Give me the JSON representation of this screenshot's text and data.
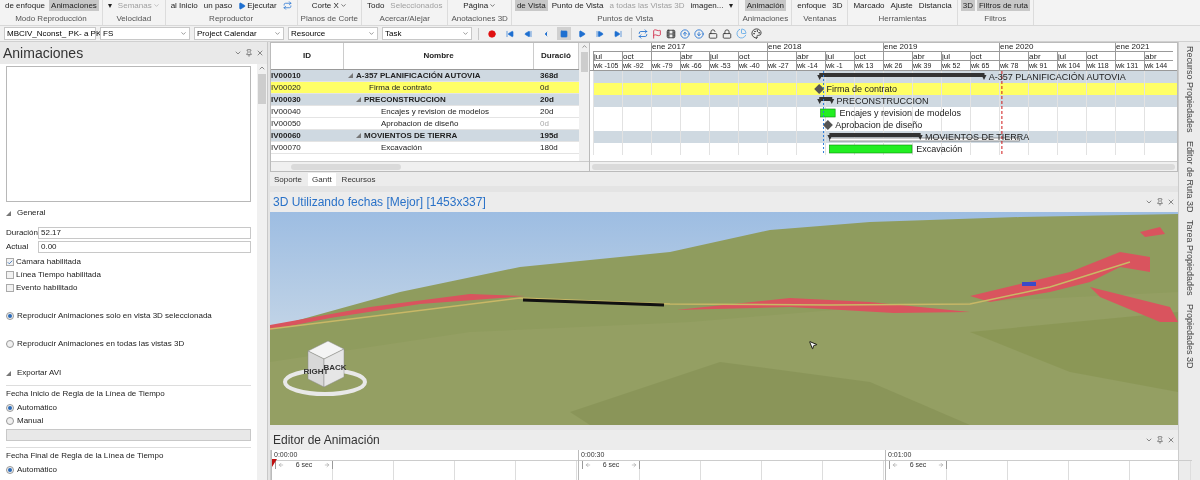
{
  "ribbon": {
    "groups": [
      {
        "label": "Modo Reproducción",
        "buttons": [
          {
            "label": "de enfoque",
            "kind": "text",
            "selected": false,
            "disabled": false
          },
          {
            "label": "Animaciones",
            "kind": "text",
            "selected": true,
            "disabled": false
          }
        ]
      },
      {
        "label": "Velocidad",
        "buttons": [
          {
            "label": "▾",
            "kind": "text",
            "selected": false,
            "disabled": false
          },
          {
            "label": "Semanas",
            "kind": "dropdown",
            "selected": false,
            "disabled": true
          }
        ]
      },
      {
        "label": "Reproductor",
        "buttons": [
          {
            "label": "al Inicio",
            "kind": "text",
            "selected": false,
            "disabled": false
          },
          {
            "label": "un paso",
            "kind": "text",
            "selected": false,
            "disabled": false
          },
          {
            "label": "Ejecutar",
            "kind": "play",
            "selected": false,
            "disabled": false
          },
          {
            "kind": "loop",
            "selected": false,
            "disabled": false
          }
        ]
      },
      {
        "label": "Planos de Corte",
        "buttons": [
          {
            "label": "Corte X",
            "kind": "dropdown",
            "selected": false,
            "disabled": false
          }
        ]
      },
      {
        "label": "Acercar/Alejar",
        "buttons": [
          {
            "label": "Todo",
            "kind": "text",
            "selected": false,
            "disabled": false
          },
          {
            "label": "Seleccionados",
            "kind": "text",
            "selected": false,
            "disabled": true
          }
        ]
      },
      {
        "label": "Anotaciones 3D",
        "buttons": [
          {
            "label": "Página",
            "kind": "dropdown",
            "selected": false,
            "disabled": false
          }
        ]
      },
      {
        "label": "Puntos de Vista",
        "buttons": [
          {
            "label": "de Vista",
            "kind": "text",
            "selected": true,
            "disabled": false
          },
          {
            "label": "Punto de Vista",
            "kind": "text",
            "selected": false,
            "disabled": false
          },
          {
            "label": "a todas las Vistas 3D",
            "kind": "text",
            "selected": false,
            "disabled": true
          },
          {
            "label": "imagen...",
            "kind": "text",
            "selected": false,
            "disabled": false
          },
          {
            "label": "▾",
            "kind": "text",
            "selected": false,
            "disabled": false
          }
        ]
      },
      {
        "label": "Animaciones",
        "buttons": [
          {
            "label": "Animación",
            "kind": "text",
            "selected": true,
            "disabled": false
          }
        ]
      },
      {
        "label": "Ventanas",
        "buttons": [
          {
            "label": "enfoque",
            "kind": "text",
            "selected": false,
            "disabled": false
          },
          {
            "label": "3D",
            "kind": "text",
            "selected": false,
            "disabled": false
          }
        ]
      },
      {
        "label": "Herramientas",
        "buttons": [
          {
            "label": "Marcado",
            "kind": "text",
            "selected": false,
            "disabled": false
          },
          {
            "label": "Ajuste",
            "kind": "text",
            "selected": false,
            "disabled": false
          },
          {
            "label": "Distancia",
            "kind": "text",
            "selected": false,
            "disabled": false
          }
        ]
      },
      {
        "label": "Filtros",
        "buttons": [
          {
            "label": "3D",
            "kind": "text",
            "selected": true,
            "disabled": false
          },
          {
            "label": "Filtros de ruta",
            "kind": "text",
            "selected": true,
            "disabled": false
          }
        ]
      }
    ]
  },
  "toolbar": {
    "dropdowns": [
      {
        "value": "MBCIV_Nconst_ PK- a PK"
      },
      {
        "value": "FS"
      },
      {
        "value": "Project Calendar"
      },
      {
        "value": "Resource"
      },
      {
        "value": "Task"
      }
    ],
    "player_buttons": [
      {
        "kind": "record",
        "selected": false
      },
      {
        "kind": "first",
        "selected": false
      },
      {
        "kind": "previous",
        "selected": false
      },
      {
        "kind": "back",
        "selected": false
      },
      {
        "kind": "stop",
        "selected": true
      },
      {
        "kind": "play",
        "selected": false
      },
      {
        "kind": "next",
        "selected": false
      },
      {
        "kind": "last",
        "selected": false
      }
    ]
  },
  "animations_panel": {
    "title": "Animaciones",
    "general": {
      "label": "General",
      "expanded": true,
      "fields": [
        {
          "label": "Duración",
          "value": "52.17"
        },
        {
          "label": "Actual",
          "value": "0.00"
        }
      ],
      "checkboxes": [
        {
          "label": "Cámara habilitada",
          "checked": true
        },
        {
          "label": "Línea Tiempo habilitada",
          "checked": false
        },
        {
          "label": "Evento habilitado",
          "checked": false
        }
      ],
      "radios": [
        {
          "label": "Reproducir Animaciones solo en vista 3D seleccionada",
          "selected": true
        },
        {
          "label": "Reproducir Animaciones en todas las vistas 3D",
          "selected": false
        }
      ]
    },
    "export": {
      "label": "Exportar AVI",
      "expanded": true,
      "groups": [
        {
          "title": "Fecha Inicio de Regla de la Línea de Tiempo",
          "options": [
            {
              "label": "Automático",
              "selected": true
            },
            {
              "label": "Manual",
              "selected": false
            }
          ],
          "field": {
            "disabled": true
          }
        },
        {
          "title": "Fecha Final de Regla de la Línea de Tiempo",
          "options": [
            {
              "label": "Automático",
              "selected": true
            }
          ]
        }
      ]
    }
  },
  "gantt": {
    "columns": [
      "ID",
      "Nombre",
      "Duració"
    ],
    "rows": [
      {
        "id": "IV00010",
        "name": "A-357 PLANIFICACIÓN AUTOVIA",
        "duration": "368d",
        "kind": "summary",
        "expanded": true,
        "selected": false,
        "disabled": false,
        "bar_label": "A-357 PLANIFICACIÓN AUTOVIA"
      },
      {
        "id": "IV00020",
        "name": "Firma de contrato",
        "duration": "0d",
        "kind": "milestone",
        "selected": true,
        "disabled": false,
        "bar_label": "Firma de contrato"
      },
      {
        "id": "IV00030",
        "name": "PRECONSTRUCCION",
        "duration": "20d",
        "kind": "summary",
        "expanded": true,
        "selected": false,
        "disabled": false,
        "bar_label": "PRECONSTRUCCION"
      },
      {
        "id": "IV00040",
        "name": "Encajes y revision de modelos",
        "duration": "20d",
        "kind": "task",
        "selected": false,
        "disabled": false,
        "bar_label": "Encajes y revision de modelos"
      },
      {
        "id": "IV00050",
        "name": "Aprobacion de diseño",
        "duration": "0d",
        "kind": "milestone",
        "selected": false,
        "disabled": true,
        "bar_label": "Aprobacion de diseño"
      },
      {
        "id": "IV00060",
        "name": "MOVIENTOS DE TIERRA",
        "duration": "195d",
        "kind": "summary",
        "expanded": true,
        "selected": false,
        "disabled": false,
        "bar_label": "MOVIENTOS DE TIERRA"
      },
      {
        "id": "IV00070",
        "name": "Excavación",
        "duration": "180d",
        "kind": "task",
        "selected": false,
        "disabled": false,
        "bar_label": "Excavación"
      }
    ],
    "timescale": [
      {
        "month": "jul",
        "week": "wk -105"
      },
      {
        "month": "oct",
        "week": "wk -92"
      },
      {
        "year": "ene 2017",
        "week": "wk -79"
      },
      {
        "month": "abr",
        "week": "wk -66"
      },
      {
        "month": "jul",
        "week": "wk -53"
      },
      {
        "month": "oct",
        "week": "wk -40"
      },
      {
        "year": "ene 2018",
        "week": "wk -27"
      },
      {
        "month": "abr",
        "week": "wk -14"
      },
      {
        "month": "jul",
        "week": "wk -1"
      },
      {
        "month": "oct",
        "week": "wk 13"
      },
      {
        "year": "ene 2019",
        "week": "wk 26"
      },
      {
        "month": "abr",
        "week": "wk 39"
      },
      {
        "month": "jul",
        "week": "wk 52"
      },
      {
        "month": "oct",
        "week": "wk 65"
      },
      {
        "year": "ene 2020",
        "week": "wk 78"
      },
      {
        "month": "abr",
        "week": "wk 91"
      },
      {
        "month": "jul",
        "week": "wk 104"
      },
      {
        "month": "oct",
        "week": "wk 118"
      },
      {
        "year": "ene 2021",
        "week": "wk 131"
      },
      {
        "month": "abr",
        "week": "wk 144"
      }
    ],
    "tabs": [
      {
        "label": "Soporte",
        "selected": false
      },
      {
        "label": "Gantt",
        "selected": true
      },
      {
        "label": "Recursos",
        "selected": false
      }
    ]
  },
  "view3d": {
    "title": "3D Utilizando fechas [Mejor] [1453x337]",
    "cube_labels": [
      "RIGHT",
      "BACK"
    ]
  },
  "animation_editor": {
    "title": "Editor de Animación",
    "marks": [
      {
        "time": "0:00:00",
        "span": "6 sec"
      },
      {
        "time": "0:00:30",
        "span": "6 sec"
      },
      {
        "time": "0:01:00",
        "span": "6 sec"
      }
    ]
  },
  "side_tabs": [
    "Recurso Propiedades",
    "Editor de Ruta 3D",
    "Tarea Propiedades",
    "Propiedades 3D"
  ]
}
